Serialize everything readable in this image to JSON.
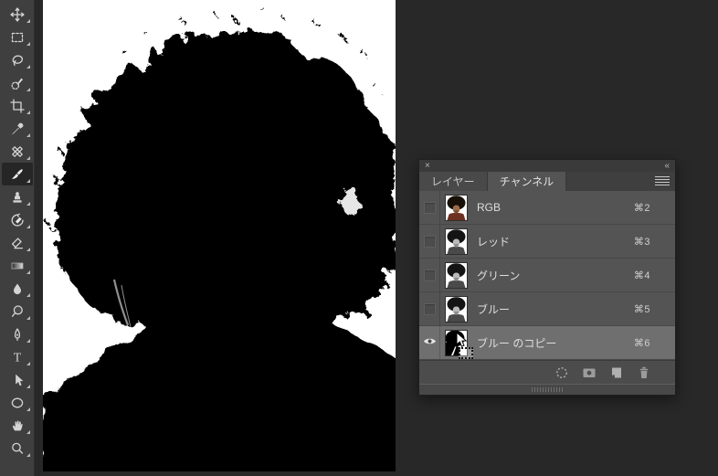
{
  "toolbar": {
    "tools": [
      {
        "icon": "move-tool",
        "selected": false
      },
      {
        "icon": "marquee-tool",
        "selected": false
      },
      {
        "icon": "lasso-tool",
        "selected": false
      },
      {
        "icon": "quick-selection-tool",
        "selected": false
      },
      {
        "icon": "crop-tool",
        "selected": false
      },
      {
        "icon": "eyedropper-tool",
        "selected": false
      },
      {
        "icon": "healing-brush-tool",
        "selected": false
      },
      {
        "icon": "brush-tool",
        "selected": true
      },
      {
        "icon": "clone-stamp-tool",
        "selected": false
      },
      {
        "icon": "history-brush-tool",
        "selected": false
      },
      {
        "icon": "eraser-tool",
        "selected": false
      },
      {
        "icon": "gradient-tool",
        "selected": false
      },
      {
        "icon": "blur-tool",
        "selected": false
      },
      {
        "icon": "dodge-tool",
        "selected": false
      },
      {
        "icon": "pen-tool",
        "selected": false
      },
      {
        "icon": "type-tool",
        "selected": false
      },
      {
        "icon": "path-selection-tool",
        "selected": false
      },
      {
        "icon": "ellipse-tool",
        "selected": false
      },
      {
        "icon": "hand-tool",
        "selected": false
      },
      {
        "icon": "zoom-tool",
        "selected": false
      }
    ]
  },
  "canvas": {
    "content": "black-and-white silhouette of a person with large afro hair"
  },
  "panel": {
    "header": {
      "close_glyph": "×",
      "collapse_glyph": "«"
    },
    "tabs": [
      {
        "label": "レイヤー",
        "active": false
      },
      {
        "label": "チャンネル",
        "active": true
      }
    ],
    "channels": [
      {
        "name": "RGB",
        "shortcut": "⌘2",
        "visible": false,
        "selected": false,
        "thumb": "color"
      },
      {
        "name": "レッド",
        "shortcut": "⌘3",
        "visible": false,
        "selected": false,
        "thumb": "gray"
      },
      {
        "name": "グリーン",
        "shortcut": "⌘4",
        "visible": false,
        "selected": false,
        "thumb": "gray"
      },
      {
        "name": "ブルー",
        "shortcut": "⌘5",
        "visible": false,
        "selected": false,
        "thumb": "gray"
      },
      {
        "name": "ブルー のコピー",
        "shortcut": "⌘6",
        "visible": true,
        "selected": true,
        "thumb": "mask"
      }
    ],
    "footer_icons": [
      "load-channel-as-selection",
      "save-selection-as-channel",
      "create-new-channel",
      "delete-channel"
    ]
  },
  "colors": {
    "app_bg": "#282828",
    "toolbar_bg": "#3f3f3f",
    "panel_row_bg": "#545454",
    "panel_selected_row_bg": "#6f6f6f",
    "panel_chrome_bg": "#3a3a3a"
  }
}
